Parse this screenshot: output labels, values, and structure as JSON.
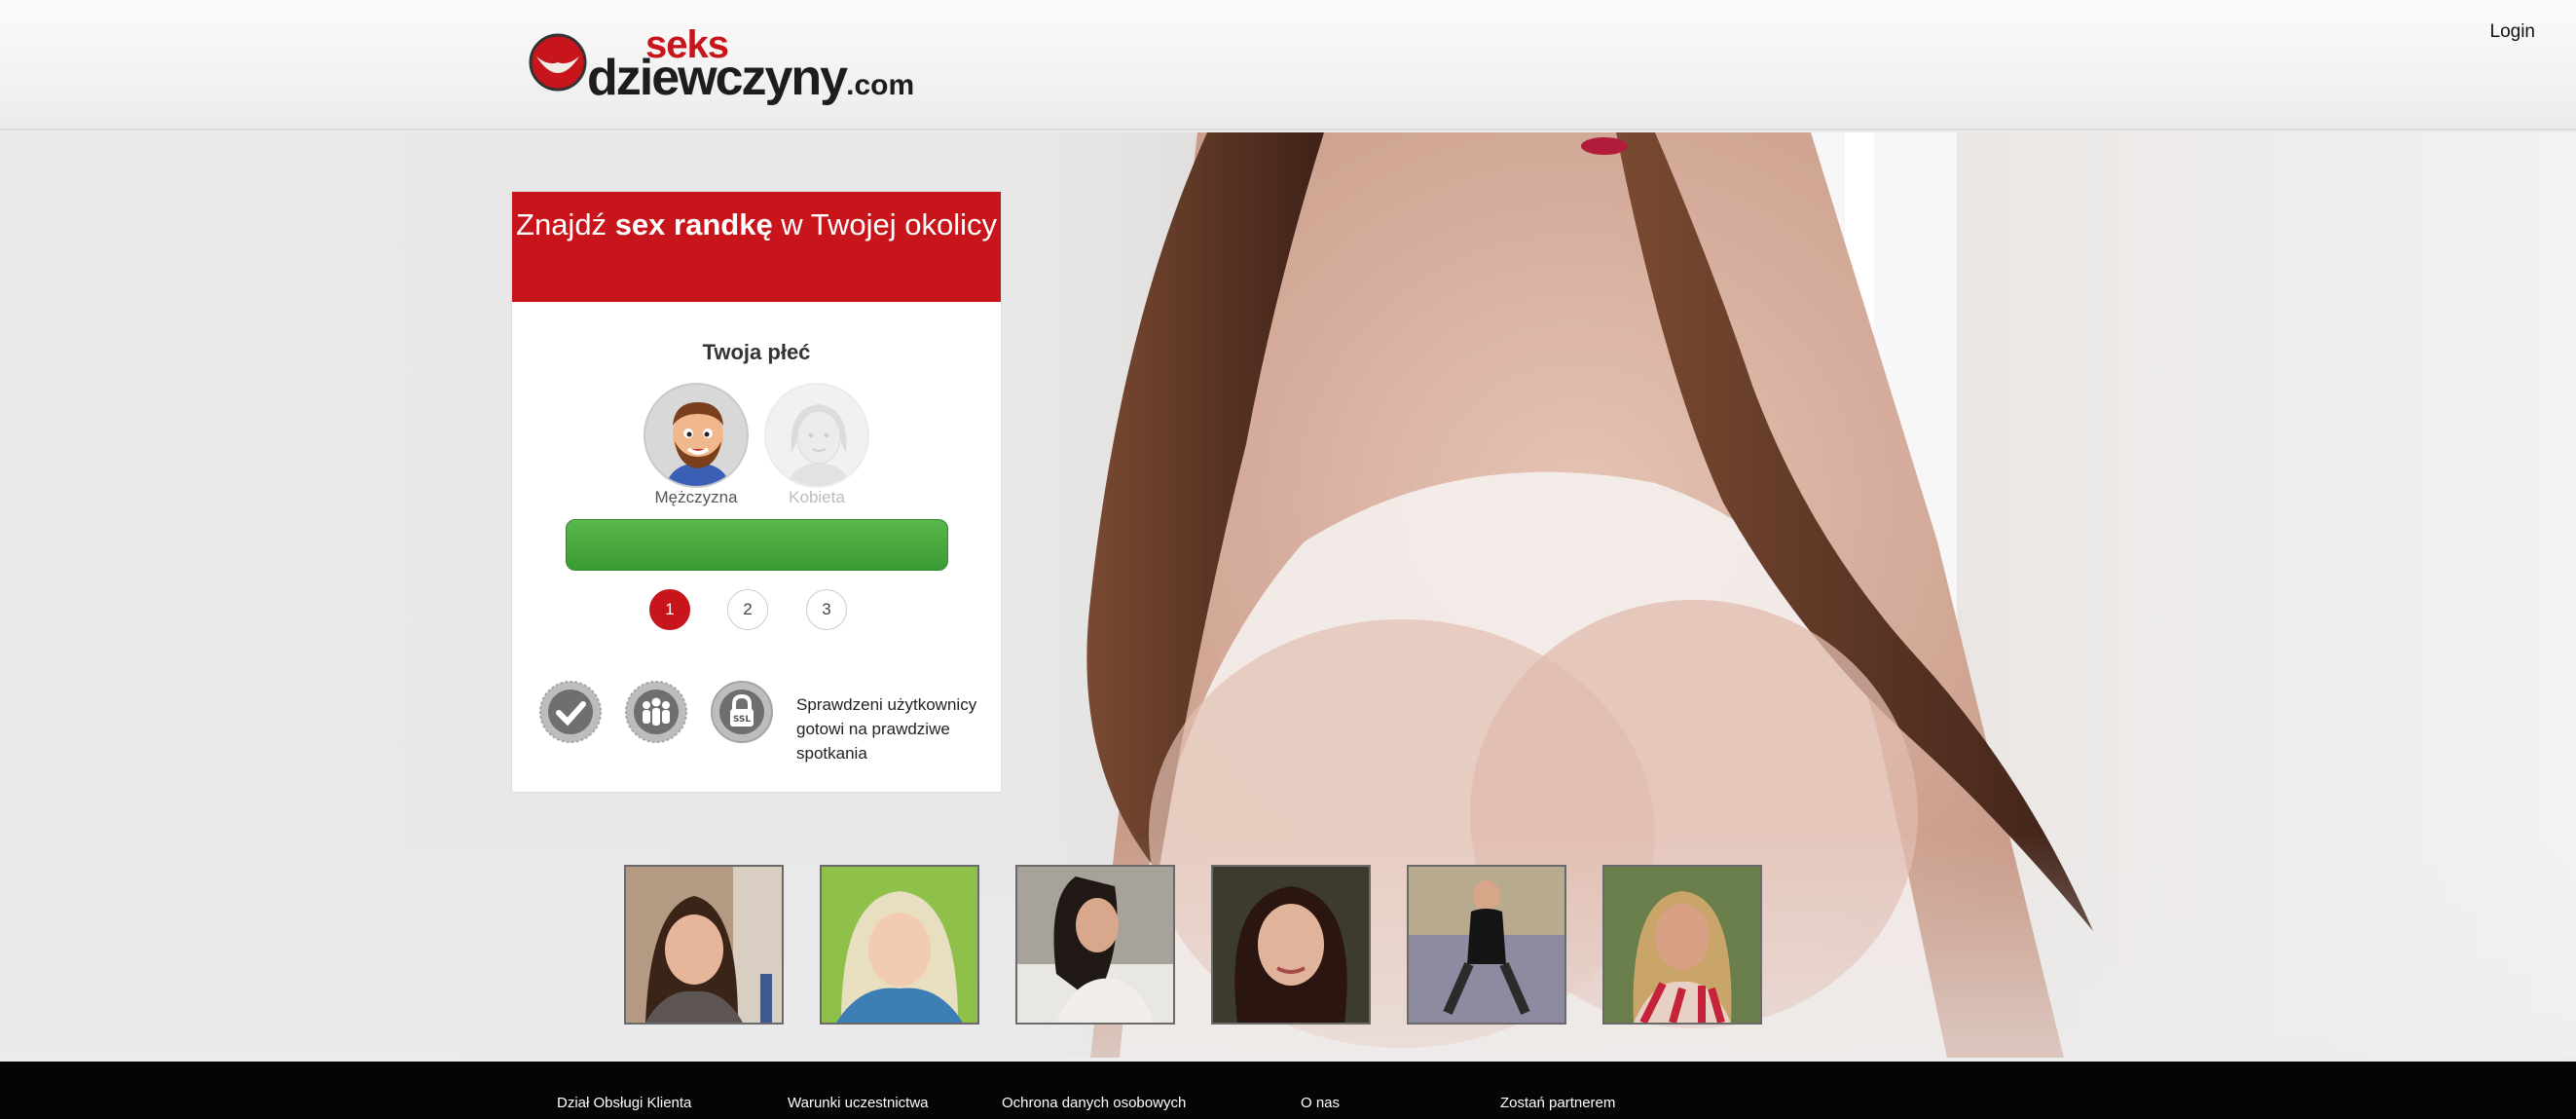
{
  "header": {
    "logo_top": "seks",
    "logo_main": "dziewczyny",
    "logo_tld": ".com",
    "login_label": "Login"
  },
  "form": {
    "title_prefix": "Znajdź ",
    "title_bold": "sex randkę",
    "title_suffix": " w Twojej okolicy",
    "gender_title": "Twoja płeć",
    "male_label": "Mężczyzna",
    "female_label": "Kobieta",
    "steps": [
      "1",
      "2",
      "3"
    ],
    "active_step": 1,
    "trust_text": "Sprawdzeni użytkownicy gotowi na prawdziwe spotkania",
    "badges": [
      "verified-check-icon",
      "users-group-icon",
      "ssl-lock-icon"
    ]
  },
  "colors": {
    "brand_red": "#c8151b",
    "cta_green": "#48a93e",
    "footer_bg": "#050505"
  },
  "footer": {
    "links": [
      "Dział Obsługi Klienta",
      "Warunki uczestnictwa",
      "Ochrona danych osobowych",
      "O nas",
      "Zostań partnerem"
    ]
  }
}
